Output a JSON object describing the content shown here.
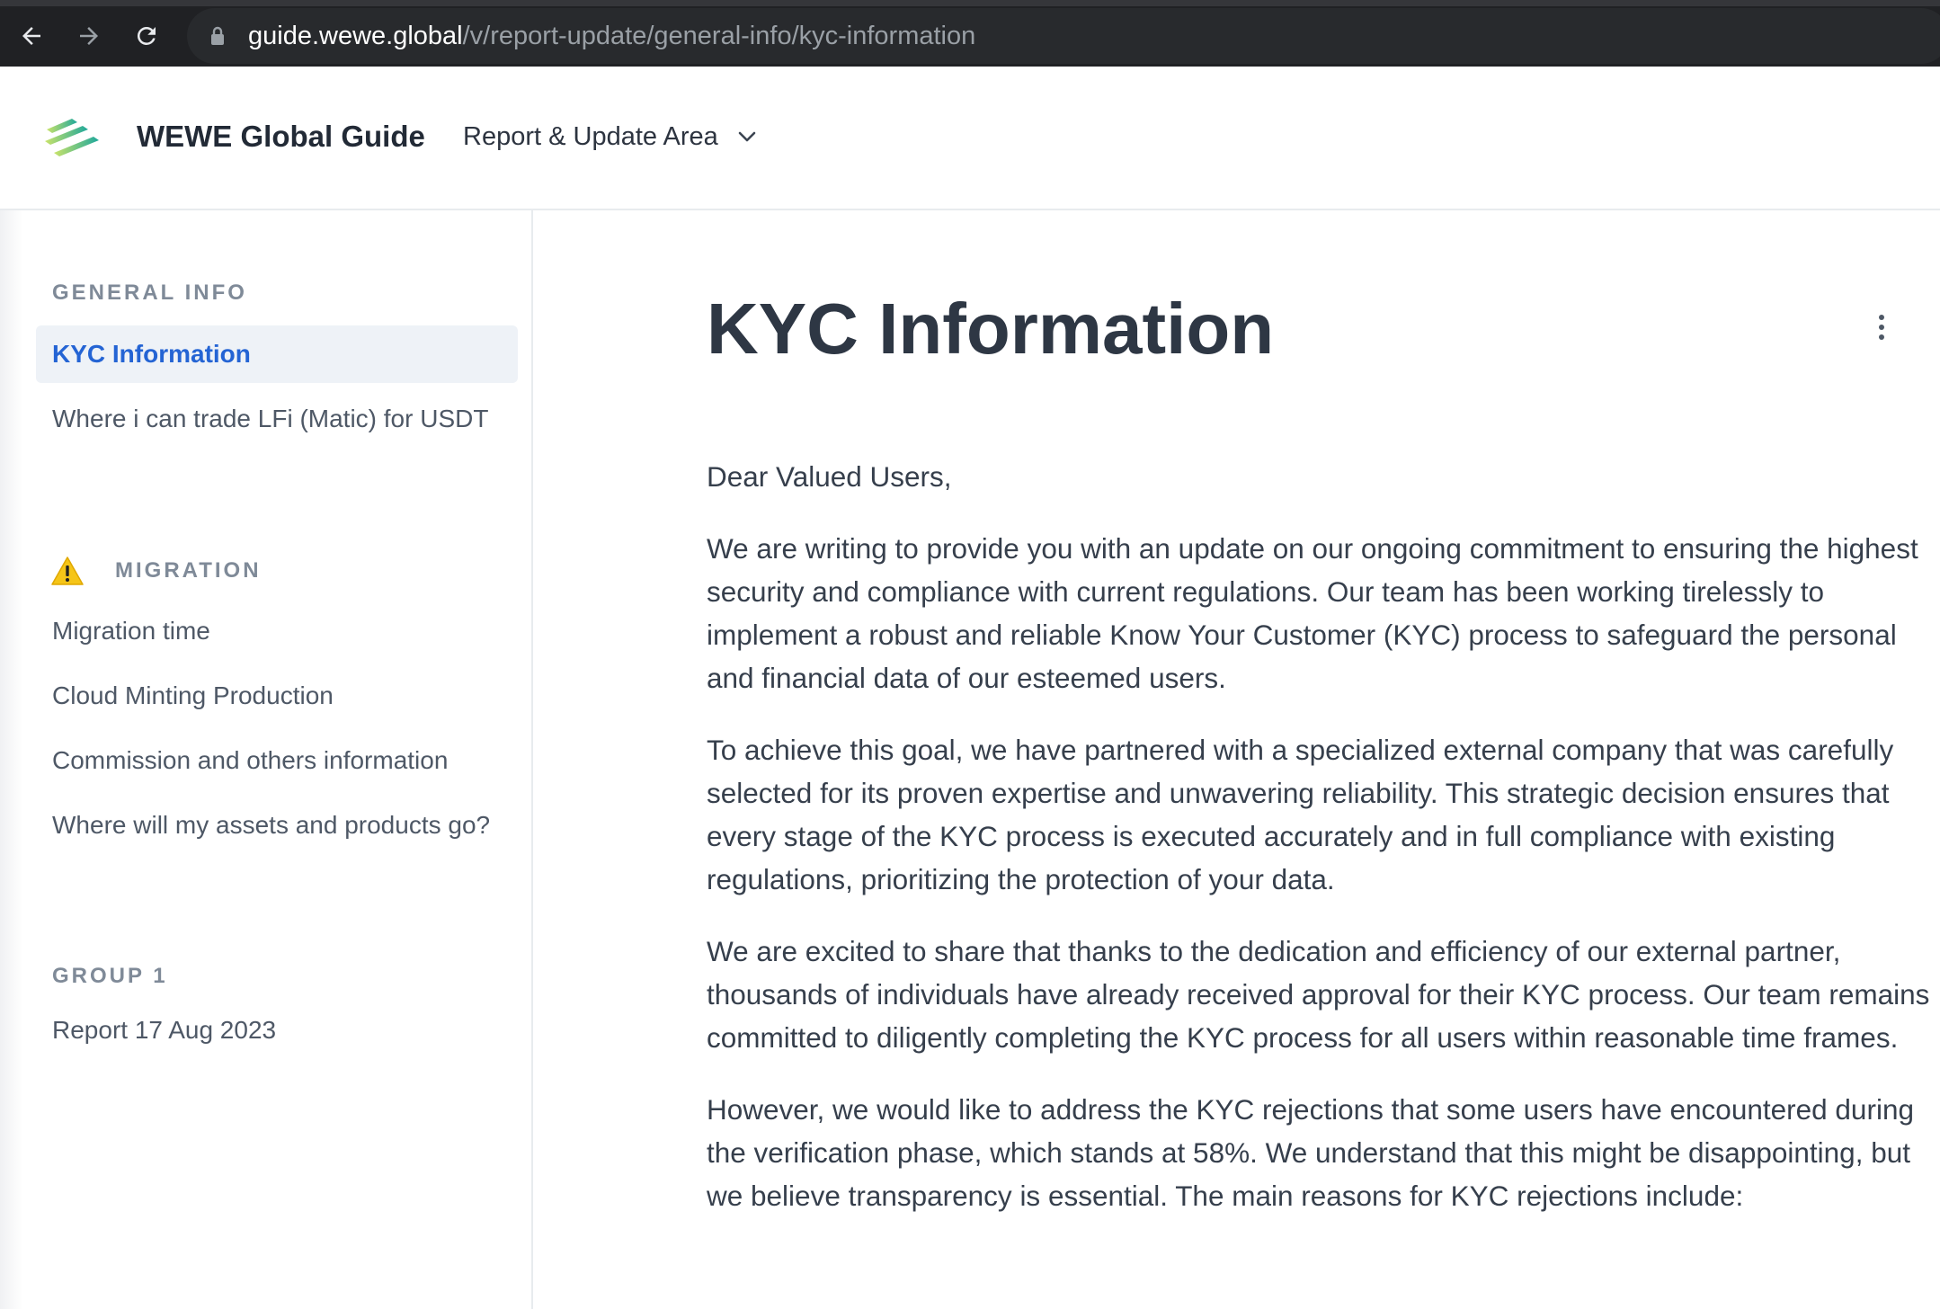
{
  "browser": {
    "url_host": "guide.wewe.global",
    "url_path": "/v/report-update/general-info/kyc-information"
  },
  "header": {
    "site_title": "WEWE Global Guide",
    "space_label": "Report & Update Area"
  },
  "sidebar": {
    "sections": [
      {
        "title": "GENERAL INFO",
        "items": [
          {
            "label": "KYC Information",
            "active": true
          },
          {
            "label": "Where i can trade LFi (Matic) for USDT"
          }
        ]
      },
      {
        "title": "MIGRATION",
        "icon": "warning-icon",
        "items": [
          {
            "label": "Migration time"
          },
          {
            "label": "Cloud Minting Production"
          },
          {
            "label": "Commission and others information"
          },
          {
            "label": "Where will my assets and products go?"
          }
        ]
      },
      {
        "title": "GROUP 1",
        "items": [
          {
            "label": "Report 17 Aug 2023"
          }
        ]
      }
    ]
  },
  "main": {
    "title": "KYC Information",
    "paragraphs": [
      "Dear Valued Users,",
      "We are writing to provide you with an update on our ongoing commitment to ensuring the highest security and compliance with current regulations. Our team has been working tirelessly to implement a robust and reliable Know Your Customer (KYC) process to safeguard the personal and financial data of our esteemed users.",
      "To achieve this goal, we have partnered with a specialized external company that was carefully selected for its proven expertise and unwavering reliability. This strategic decision ensures that every stage of the KYC process is executed accurately and in full compliance with existing regulations, prioritizing the protection of your data.",
      "We are excited to share that thanks to the dedication and efficiency of our external partner, thousands of individuals have already received approval for their KYC process. Our team remains committed to diligently completing the KYC process for all users within reasonable time frames.",
      "However, we would like to address the KYC rejections that some users have encountered during the verification phase, which stands at 58%. We understand that this might be disappointing, but we believe transparency is essential. The main reasons for KYC rejections include:"
    ]
  },
  "colors": {
    "browser_bg": "#202124",
    "active_link": "#2464d4",
    "active_bg": "#eef2f7",
    "warning": "#f5c518"
  }
}
